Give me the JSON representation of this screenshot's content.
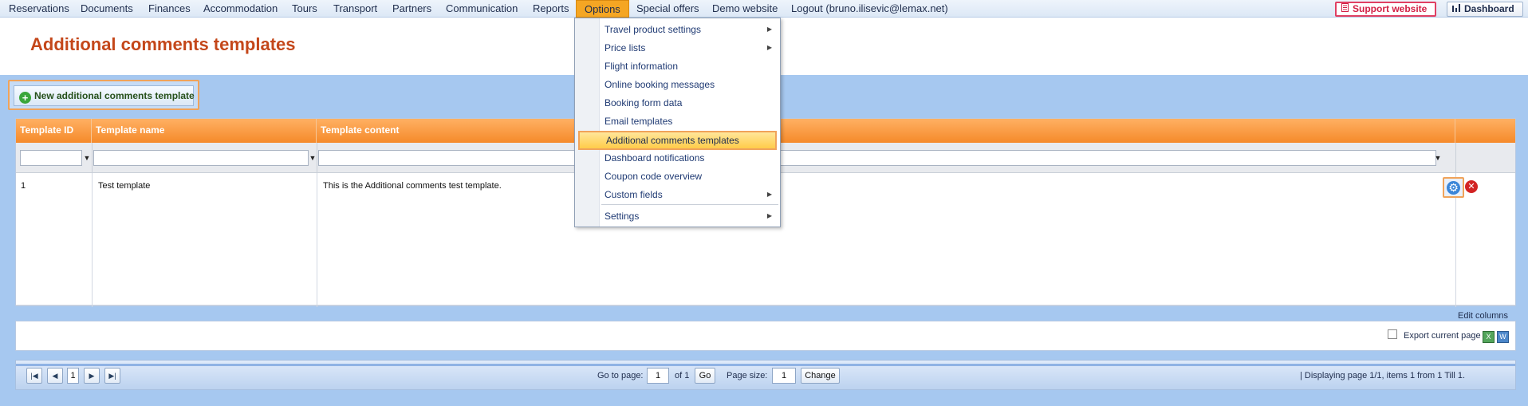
{
  "menu": {
    "items": [
      "Reservations",
      "Documents",
      "Finances",
      "Accommodation",
      "Tours",
      "Transport",
      "Partners",
      "Communication",
      "Reports",
      "Options",
      "Special offers",
      "Demo website",
      "Logout (bruno.ilisevic@lemax.net)"
    ],
    "active": "Options",
    "support_label": "Support website",
    "dashboard_label": "Dashboard"
  },
  "page": {
    "title": "Additional comments templates"
  },
  "toolbar": {
    "new_label": "New additional comments template"
  },
  "grid": {
    "columns": [
      "Template ID",
      "Template name",
      "Template content"
    ],
    "rows": [
      {
        "id": "1",
        "name": "Test template",
        "content": "This is the Additional comments test template."
      }
    ],
    "edit_columns_label": "Edit columns",
    "export_label": "Export current page"
  },
  "pager": {
    "first": "|◀",
    "prev": "◀",
    "next": "▶",
    "last": "▶|",
    "current_page": "1",
    "goto_label": "Go to page:",
    "goto_value": "1",
    "of_label": "of 1",
    "go_label": "Go",
    "page_size_label": "Page size:",
    "page_size_value": "1",
    "change_label": "Change",
    "info": "| Displaying page  1/1,  items  1  from  1  Till  1."
  },
  "dropdown": {
    "items": [
      {
        "label": "Travel product settings",
        "submenu": true
      },
      {
        "label": "Price lists",
        "submenu": true
      },
      {
        "label": "Flight information",
        "submenu": false
      },
      {
        "label": "Online booking messages",
        "submenu": false
      },
      {
        "label": "Booking form data",
        "submenu": false
      },
      {
        "label": "Email templates",
        "submenu": false
      },
      {
        "label": "Additional comments templates",
        "submenu": false,
        "highlighted": true
      },
      {
        "label": "Dashboard notifications",
        "submenu": false
      },
      {
        "label": "Coupon code overview",
        "submenu": false
      },
      {
        "label": "Custom fields",
        "submenu": true
      },
      {
        "label": "Settings",
        "submenu": true
      }
    ]
  },
  "colors": {
    "accent": "#f5a623",
    "title": "#c4471a",
    "header": "#f58a2a",
    "work_bg": "#a6c8f0"
  }
}
